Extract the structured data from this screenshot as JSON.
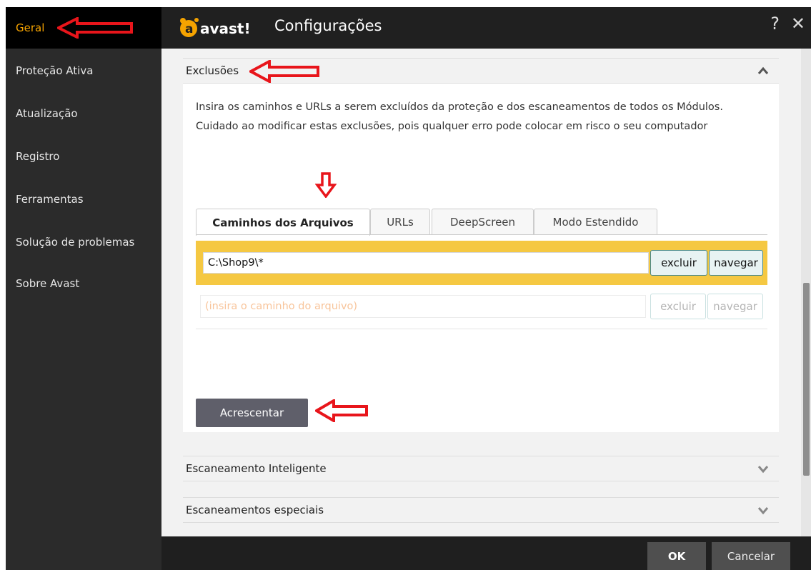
{
  "app": {
    "brand": "avast!",
    "title": "Configurações",
    "help_glyph": "?",
    "close_glyph": "✕"
  },
  "sidebar": {
    "items": [
      {
        "label": "Geral",
        "active": true
      },
      {
        "label": "Proteção Ativa"
      },
      {
        "label": "Atualização"
      },
      {
        "label": "Registro"
      },
      {
        "label": "Ferramentas"
      },
      {
        "label": "Solução de problemas"
      },
      {
        "label": "Sobre Avast"
      }
    ]
  },
  "exclusions": {
    "heading": "Exclusões",
    "description": "Insira os caminhos e URLs a serem excluídos da proteção e dos escaneamentos de todos os Módulos. Cuidado ao modificar estas exclusões, pois qualquer erro pode colocar em risco o seu computador",
    "tabs": [
      {
        "label": "Caminhos dos Arquivos",
        "active": true
      },
      {
        "label": "URLs"
      },
      {
        "label": "DeepScreen"
      },
      {
        "label": "Modo Estendido"
      }
    ],
    "rows": [
      {
        "value": "C:\\Shop9\\*",
        "exclude_label": "excluir",
        "browse_label": "navegar"
      },
      {
        "placeholder": "(insira o caminho do arquivo)",
        "exclude_label": "excluir",
        "browse_label": "navegar"
      }
    ],
    "add_label": "Acrescentar"
  },
  "sections": [
    {
      "label": "Escaneamento Inteligente"
    },
    {
      "label": "Escaneamentos especiais"
    }
  ],
  "footer": {
    "ok_label": "OK",
    "cancel_label": "Cancelar"
  },
  "colors": {
    "accent_orange": "#f5a300",
    "highlight_row": "#f5c842",
    "annotation_red": "#e8151b"
  },
  "icons": [
    "arrow-annotation-icon",
    "chevron-up-icon",
    "chevron-down-icon",
    "help-icon",
    "close-icon",
    "avast-logo"
  ]
}
